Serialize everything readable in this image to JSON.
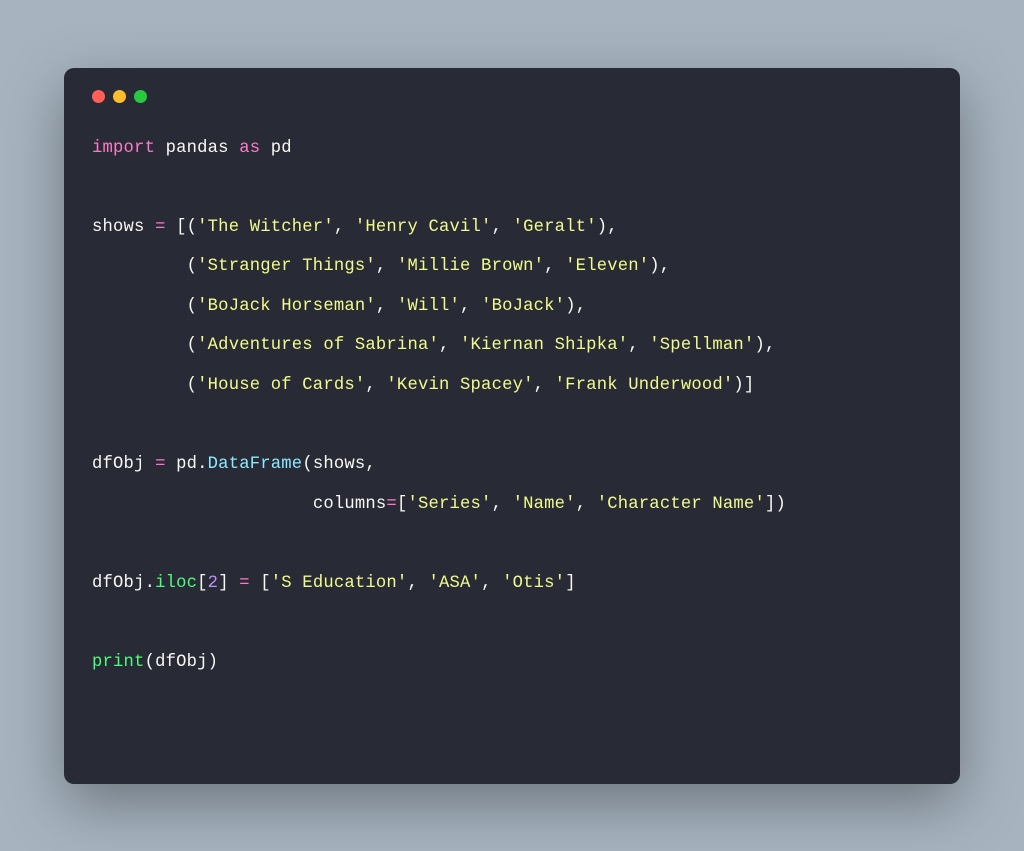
{
  "code": {
    "line1": {
      "import": "import",
      "pandas": "pandas",
      "as": "as",
      "pd": "pd"
    },
    "line3": {
      "shows": "shows",
      "eq": "=",
      "lb": "[(",
      "s1": "'The Witcher'",
      "c": ", ",
      "s2": "'Henry Cavil'",
      "s3": "'Geralt'",
      "rp": "),"
    },
    "line4": {
      "pad": "         (",
      "s1": "'Stranger Things'",
      "c": ", ",
      "s2": "'Millie Brown'",
      "s3": "'Eleven'",
      "rp": "),"
    },
    "line5": {
      "pad": "         (",
      "s1": "'BoJack Horseman'",
      "c": ", ",
      "s2": "'Will'",
      "s3": "'BoJack'",
      "rp": "),"
    },
    "line6": {
      "pad": "         (",
      "s1": "'Adventures of Sabrina'",
      "c": ", ",
      "s2": "'Kiernan Shipka'",
      "s3": "'Spellman'",
      "rp": "),"
    },
    "line7": {
      "pad": "         (",
      "s1": "'House of Cards'",
      "c": ", ",
      "s2": "'Kevin Spacey'",
      "s3": "'Frank Underwood'",
      "rp": ")]"
    },
    "line9": {
      "dfObj": "dfObj",
      "eq": "=",
      "pd": "pd",
      "dot": ".",
      "DataFrame": "DataFrame",
      "lp": "(",
      "shows": "shows",
      "comma": ","
    },
    "line10": {
      "pad": "                     ",
      "columns": "columns",
      "eq": "=",
      "lb": "[",
      "s1": "'Series'",
      "c": ", ",
      "s2": "'Name'",
      "s3": "'Character Name'",
      "rb": "])"
    },
    "line12": {
      "dfObj": "dfObj",
      "dot": ".",
      "iloc": "iloc",
      "lb": "[",
      "two": "2",
      "rb": "]",
      "eq": "=",
      "lb2": "[",
      "s1": "'S Education'",
      "c": ", ",
      "s2": "'ASA'",
      "s3": "'Otis'",
      "rb2": "]"
    },
    "line14": {
      "print": "print",
      "lp": "(",
      "dfObj": "dfObj",
      "rp": ")"
    }
  }
}
